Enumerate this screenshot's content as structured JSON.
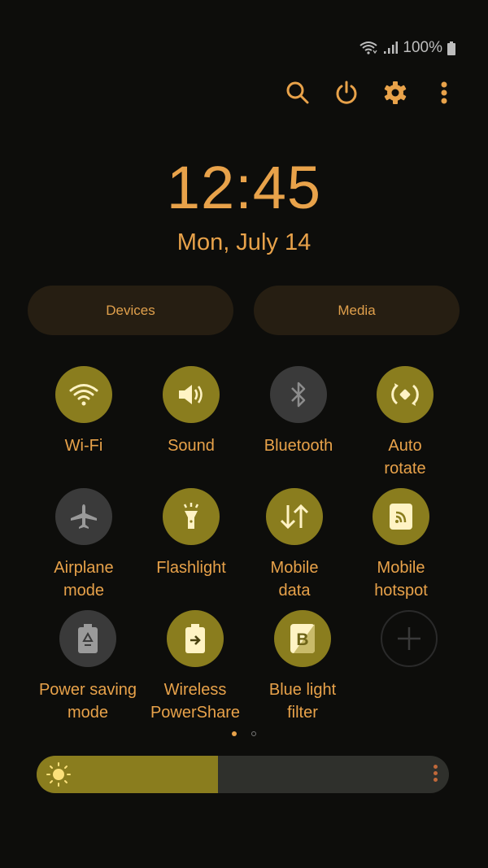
{
  "status_bar": {
    "battery_text": "100%",
    "icons": [
      "wifi-icon",
      "signal-icon",
      "battery-icon"
    ]
  },
  "toolbar": {
    "icons": [
      "search-icon",
      "power-icon",
      "settings-icon",
      "more-options-icon"
    ]
  },
  "clock": {
    "time": "12:45",
    "date": "Mon, July 14"
  },
  "pills": {
    "devices": "Devices",
    "media": "Media"
  },
  "tiles": [
    {
      "label": "Wi-Fi",
      "icon": "wifi-icon",
      "state": "on"
    },
    {
      "label": "Sound",
      "icon": "sound-icon",
      "state": "on"
    },
    {
      "label": "Bluetooth",
      "icon": "bluetooth-icon",
      "state": "off"
    },
    {
      "label": "Auto\nrotate",
      "icon": "auto-rotate-icon",
      "state": "on"
    },
    {
      "label": "Airplane\nmode",
      "icon": "airplane-icon",
      "state": "off"
    },
    {
      "label": "Flashlight",
      "icon": "flashlight-icon",
      "state": "on"
    },
    {
      "label": "Mobile\ndata",
      "icon": "mobile-data-icon",
      "state": "on"
    },
    {
      "label": "Mobile\nhotspot",
      "icon": "hotspot-icon",
      "state": "on"
    },
    {
      "label": "Power saving\nmode",
      "icon": "power-saving-icon",
      "state": "off"
    },
    {
      "label": "Wireless\nPowerShare",
      "icon": "wireless-powershare-icon",
      "state": "on"
    },
    {
      "label": "Blue light\nfilter",
      "icon": "blue-light-filter-icon",
      "state": "on"
    },
    {
      "label": "",
      "icon": "add-icon",
      "state": "add"
    }
  ],
  "pagination": {
    "current": 1,
    "total": 2
  },
  "brightness": {
    "level_percent": 44
  },
  "colors": {
    "accent": "#e8a24a",
    "tile_on": "#8a7d1e",
    "tile_off": "#3a3a3a",
    "background": "#0d0d0b"
  }
}
